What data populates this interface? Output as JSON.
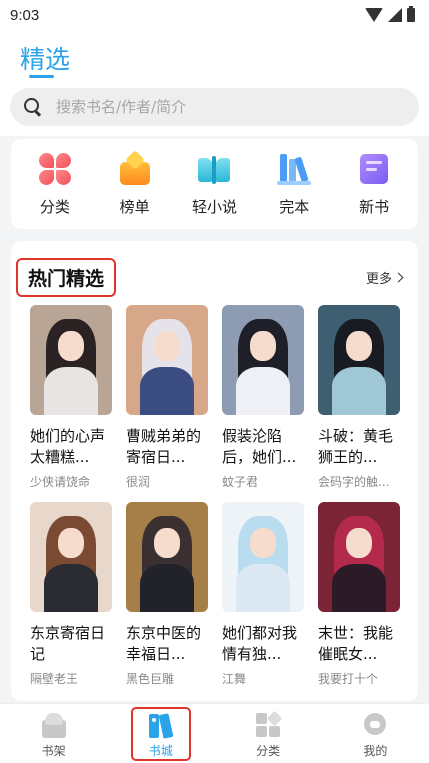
{
  "status_bar": {
    "time": "9:03"
  },
  "header": {
    "title": "精选"
  },
  "search": {
    "placeholder": "搜索书名/作者/简介"
  },
  "categories": [
    {
      "label": "分类",
      "icon": "flower-grid-icon"
    },
    {
      "label": "榜单",
      "icon": "ranking-icon"
    },
    {
      "label": "轻小说",
      "icon": "open-book-icon"
    },
    {
      "label": "完本",
      "icon": "bookshelf-icon"
    },
    {
      "label": "新书",
      "icon": "new-book-icon"
    }
  ],
  "featured": {
    "title": "热门精选",
    "more_label": "更多",
    "books": [
      {
        "title": "她们的心声太糟糕...",
        "author": "少侠请饶命",
        "palette": {
          "bg": "#b9a596",
          "hair": "#2b2323",
          "body": "#e9e4e4"
        }
      },
      {
        "title": "曹贼弟弟的寄宿日...",
        "author": "很润",
        "palette": {
          "bg": "#d7a789",
          "hair": "#e6e2ea",
          "body": "#3c4d83"
        }
      },
      {
        "title": "假装沦陷后，她们...",
        "author": "蚊子君",
        "palette": {
          "bg": "#8d9bb3",
          "hair": "#1f1f2a",
          "body": "#eef0f5"
        }
      },
      {
        "title": "斗破：黄毛狮王的...",
        "author": "会码字的触...",
        "palette": {
          "bg": "#3e5f72",
          "hair": "#181b22",
          "body": "#9fc7d6"
        }
      },
      {
        "title": "东京寄宿日记",
        "author": "隔壁老王",
        "palette": {
          "bg": "#e7d8cb",
          "hair": "#7a4a33",
          "body": "#2b2b33"
        }
      },
      {
        "title": "东京中医的幸福日...",
        "author": "黑色巨雕",
        "palette": {
          "bg": "#a67e48",
          "hair": "#3a3031",
          "body": "#22232a"
        }
      },
      {
        "title": "她们都对我情有独...",
        "author": "江舞",
        "palette": {
          "bg": "#eef3f8",
          "hair": "#b9dcef",
          "body": "#dce9f5"
        }
      },
      {
        "title": "末世：我能催眠女...",
        "author": "我要打十个",
        "palette": {
          "bg": "#7a2436",
          "hair": "#b42a4c",
          "body": "#2a1b26"
        }
      }
    ]
  },
  "bottom_nav": [
    {
      "label": "书架",
      "icon": "bookshelf-nav-icon",
      "active": false
    },
    {
      "label": "书城",
      "icon": "bookstore-nav-icon",
      "active": true
    },
    {
      "label": "分类",
      "icon": "category-nav-icon",
      "active": false
    },
    {
      "label": "我的",
      "icon": "profile-nav-icon",
      "active": false
    }
  ],
  "colors": {
    "accent": "#2aa3e8",
    "highlight_border": "#e0352b"
  }
}
